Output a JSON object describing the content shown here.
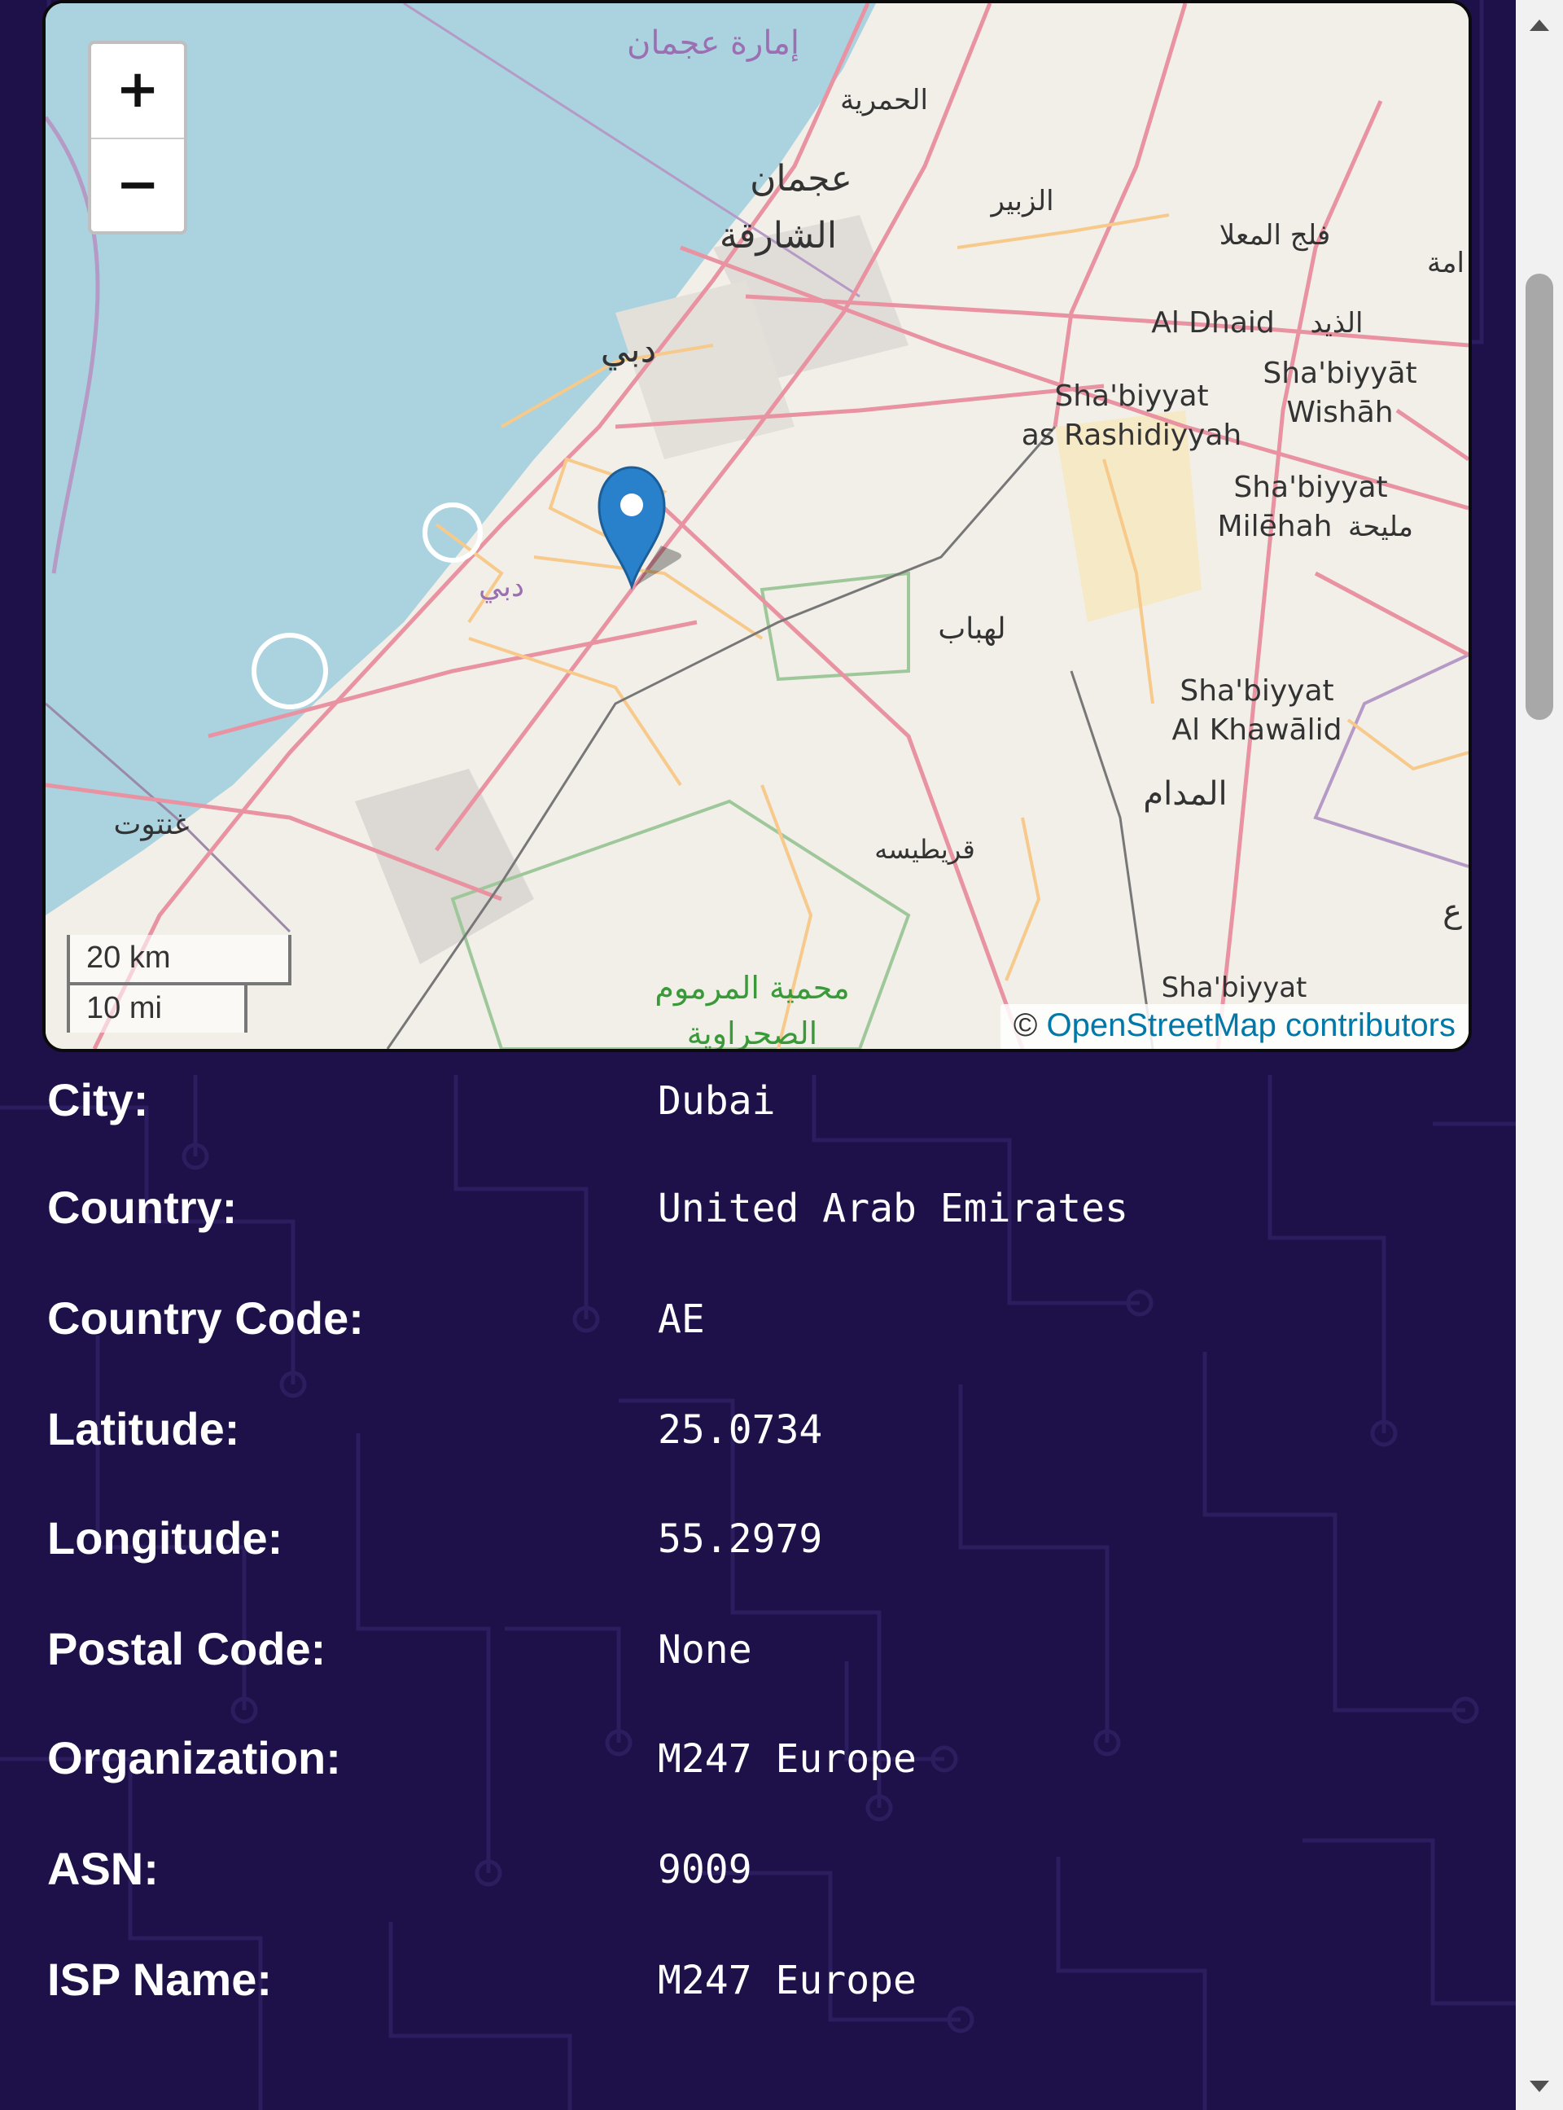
{
  "map": {
    "zoom_in_label": "+",
    "zoom_out_label": "−",
    "scale_km": "20 km",
    "scale_mi": "10 mi",
    "attribution_prefix": "©",
    "attribution_link": "OpenStreetMap contributors",
    "labels": {
      "ajman_emirate": "إمارة عجمان",
      "hamriyah": "الحمرية",
      "ajman": "عجمان",
      "zubair": "الزبير",
      "sharjah": "الشارقة",
      "falaj_al_mualla": "فلج المعلا",
      "hamah": "امة",
      "al_dhaid": "Al Dhaid",
      "al_dhaid_ar": "الذيد",
      "dubai": "دبي",
      "shabiyyat_rashidiyyah_1": "Sha'biyyat",
      "shabiyyat_rashidiyyah_2": "as Rashidiyyah",
      "shabiyyat_wishah_1": "Sha'biyyāt",
      "shabiyyat_wishah_2": "Wishāh",
      "shabiyyat_milehah_1": "Sha'biyyat",
      "shabiyyat_milehah_2": "Milēhah",
      "milehah_ar": "مليحة",
      "dubai_2": "دبي",
      "lahbab": "لهباب",
      "shabiyyat_khawalid_1": "Sha'biyyat",
      "shabiyyat_khawalid_2": "Al Khawālid",
      "ghantoot": "غنتوت",
      "madam": "المدام",
      "quraytisah": "قريطيسه",
      "marmoom_1": "محمية المرموم",
      "marmoom_2": "الصحراوية",
      "shabiyyat_bottom": "Sha'biyyat",
      "ain": "ع"
    }
  },
  "info": [
    {
      "label": "City:",
      "value": "Dubai"
    },
    {
      "label": "Country:",
      "value": "United Arab Emirates"
    },
    {
      "label": "Country Code:",
      "value": "AE"
    },
    {
      "label": "Latitude:",
      "value": "25.0734"
    },
    {
      "label": "Longitude:",
      "value": "55.2979"
    },
    {
      "label": "Postal Code:",
      "value": "None"
    },
    {
      "label": "Organization:",
      "value": "M247 Europe"
    },
    {
      "label": "ASN:",
      "value": "9009"
    },
    {
      "label": "ISP Name:",
      "value": "M247 Europe"
    }
  ],
  "colors": {
    "background": "#1e1049",
    "circuit": "#2b1d5e",
    "water": "#aad3df",
    "land": "#f2efe9",
    "road_primary": "#e892a2",
    "road_secondary": "#f7c98a",
    "marker": "#2a81cb"
  }
}
